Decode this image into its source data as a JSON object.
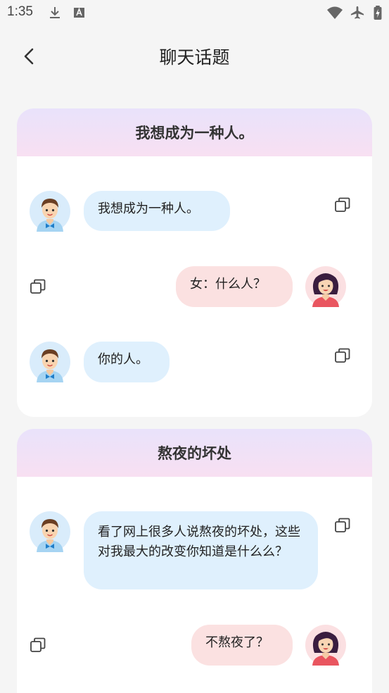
{
  "status_bar": {
    "time": "1:35",
    "icons": [
      "download-icon",
      "a-notification-icon",
      "wifi-icon",
      "airplane-icon",
      "battery-charging-icon"
    ]
  },
  "header": {
    "title": "聊天话题",
    "back_icon": "chevron-left-icon"
  },
  "topics": [
    {
      "title": "我想成为一种人。",
      "messages": [
        {
          "side": "left",
          "avatar": "male-avatar",
          "text": "我想成为一种人。"
        },
        {
          "side": "right",
          "avatar": "female-avatar",
          "text": "女：什么人？"
        },
        {
          "side": "left",
          "avatar": "male-avatar",
          "text": "你的人。"
        }
      ]
    },
    {
      "title": "熬夜的坏处",
      "messages": [
        {
          "side": "left",
          "avatar": "male-avatar",
          "text": "看了网上很多人说熬夜的坏处，这些对我最大的改变你知道是什么么？"
        },
        {
          "side": "right",
          "avatar": "female-avatar",
          "text": "不熬夜了？"
        }
      ]
    }
  ],
  "copy_icon": "copy-icon",
  "colors": {
    "background": "#f5f5f5",
    "card_header_top": "#e9e2fb",
    "card_header_bottom": "#f8e0f2",
    "left_bubble": "#dff0fd",
    "right_bubble": "#fbe1e1"
  }
}
